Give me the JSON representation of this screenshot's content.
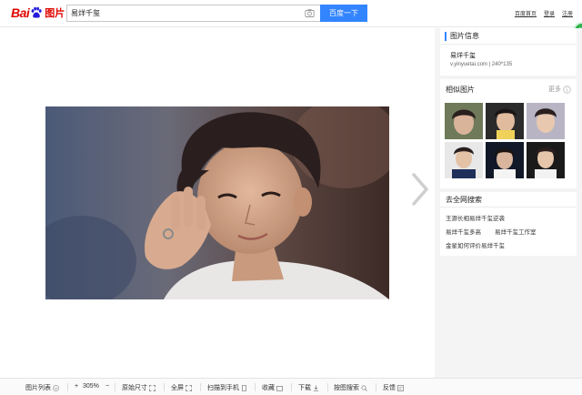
{
  "header": {
    "logo_text": "Bai",
    "logo_suffix": "图片",
    "search_value": "易烊千玺",
    "search_button": "百度一下",
    "links": [
      "百度首页",
      "登录",
      "注册"
    ]
  },
  "side_tab": {
    "label": "分"
  },
  "right_panel": {
    "info_title": "图片信息",
    "image_title": "易烊千玺",
    "image_meta": "v.yinyuetai.com   |   240*135",
    "similar_title": "相似图片",
    "similar_more": "更多",
    "search_title": "去全网搜索",
    "related_searches": [
      "王源长相易烊千玺逆袭",
      "易烊千玺多高",
      "易烊千玺工作室",
      "金星如何评价易烊千玺"
    ]
  },
  "toolbar": {
    "list": "图片列表",
    "zoom_in": "+",
    "zoom": "305%",
    "zoom_out": "−",
    "original": "原始尺寸",
    "fullscreen": "全屏",
    "scan": "扫描到手机",
    "favorite": "收藏",
    "download": "下载",
    "search_by_image": "按图搜索",
    "feedback": "反馈"
  },
  "colors": {
    "brand_red": "#e10601",
    "accent_blue": "#3385ff",
    "side_green": "#2bb24c"
  }
}
